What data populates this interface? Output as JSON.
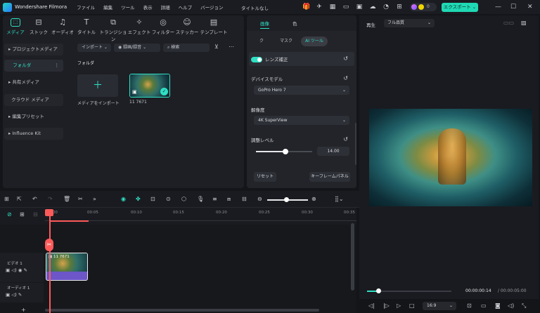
{
  "app": {
    "name": "Wondershare Filmora",
    "project": "タイトルなし"
  },
  "menu": [
    "ファイル",
    "編集",
    "ツール",
    "表示",
    "詳細",
    "ヘルプ",
    "バージョン"
  ],
  "credits": "0",
  "export_label": "エクスポート ⌄",
  "media_tabs": [
    "メディア",
    "ストック",
    "オーディオ",
    "タイトル",
    "トランジション",
    "エフェクト",
    "フィルター",
    "ステッカー",
    "テンプレート"
  ],
  "sidebar": {
    "project_media": "プロジェクトメディア",
    "folder": "フォルダ",
    "shared_media": "共有メディア",
    "cloud_media": "クラウド メディア",
    "edit_presets": "編集プリセット",
    "influence_kit": "Influence Kit"
  },
  "toolbar": {
    "import": "インポート",
    "record": "録画/録音",
    "search_placeholder": "検索"
  },
  "media": {
    "folder_heading": "フォルダ",
    "import_label": "メディアをインポート",
    "clip_name": "11 7671"
  },
  "inspector": {
    "tabs": [
      "画像",
      "色"
    ],
    "subtabs": [
      "ク",
      "マスク",
      "AI ツール"
    ],
    "lens_correction": "レンズ補正",
    "device_model_label": "デバイスモデル",
    "device_model": "GoPro Hero 7",
    "resolution_label": "解像度",
    "resolution": "4K SuperView",
    "adjust_level_label": "調整レベル",
    "adjust_level_value": "14.00",
    "reset_button": "リセット",
    "keyframe_button": "キーフレームパネル"
  },
  "preview": {
    "play_label": "再生",
    "quality": "フル品質",
    "current_time": "00:00:00:14",
    "total_time": "/ 00:00:05:00",
    "ratio": "16:9"
  },
  "timeline": {
    "ruler": [
      "00:00",
      "00:05",
      "00:10",
      "00:15",
      "00:20",
      "00:25",
      "00:30",
      "00:35"
    ],
    "video_track": "ビデオ 1",
    "audio_track": "オーディオ 1",
    "clip_name": "11 7671"
  },
  "colors": {
    "accent": "#2fe0c5",
    "playhead": "#ff5a5a",
    "clip_audio": "#6c56c8"
  }
}
